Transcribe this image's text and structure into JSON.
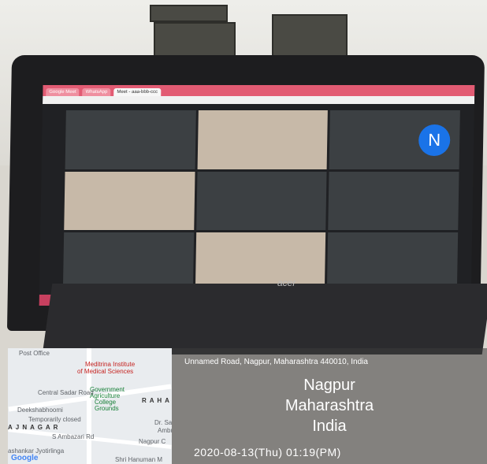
{
  "photo": {
    "subject": "laptop showing video meeting",
    "screen": {
      "tabs": [
        "Google Meet",
        "WhatsApp",
        "Meet - aaa-bbb-ccc"
      ],
      "participant_initial": "N"
    },
    "laptop_brand": "acer"
  },
  "geotag": {
    "address": "Unnamed Road, Nagpur, Maharashtra 440010, India",
    "city": "Nagpur",
    "state": "Maharashtra",
    "country": "India",
    "datetime": "2020-08-13(Thu)  01:19(PM)"
  },
  "map": {
    "labels": {
      "post_office": "Post Office",
      "meditrina": "Meditrina Institute",
      "meditrina2": "of Medical Sciences",
      "govt": "Government",
      "agri": "Agriculture",
      "college": "College",
      "grounds": "Grounds",
      "sadar": "Central Sadar Road",
      "deekshabhoomi": "Deekshabhoomi",
      "temp": "Temporarily closed",
      "rahate": "R A H A",
      "ajnagar": "A J  N A G A R",
      "ambazari": "S Ambazari Rd",
      "drs": "Dr. Sa",
      "ambu": "Ambu",
      "nagpurc": "Nagpur C",
      "jyotirlinga": "ashankar Jyotirlinga",
      "hanuman": "Shri Hanuman M",
      "google": "Google"
    }
  }
}
